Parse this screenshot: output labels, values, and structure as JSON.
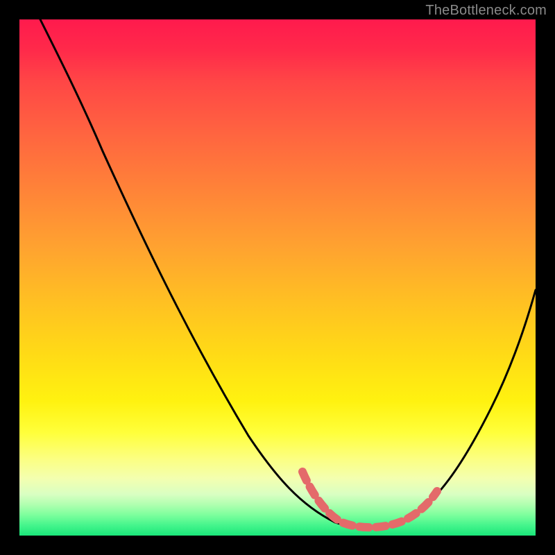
{
  "watermark": "TheBottleneck.com",
  "colors": {
    "background": "#000000",
    "curve_primary": "#000000",
    "curve_accent": "#e46a6a",
    "gradient_top": "#ff1a4d",
    "gradient_mid": "#ffe016",
    "gradient_bottom": "#1ae67a"
  },
  "chart_data": {
    "type": "line",
    "title": "",
    "xlabel": "",
    "ylabel": "",
    "xlim": [
      0,
      100
    ],
    "ylim": [
      0,
      100
    ],
    "grid": false,
    "legend": false,
    "description": "V-shaped bottleneck curve on vertical red-to-green gradient background; minimum plateau sits near the bottom (favorable) region; values estimated from pixel positions, 0 = bottom, 100 = top.",
    "series": [
      {
        "name": "bottleneck-curve-full",
        "color": "#000000",
        "x": [
          4,
          10,
          16,
          22,
          28,
          34,
          40,
          46,
          50,
          54,
          58,
          62,
          66,
          70,
          74,
          78,
          82,
          86,
          90,
          94,
          100
        ],
        "y": [
          100,
          91,
          82,
          72,
          62,
          52,
          42,
          32,
          24,
          17,
          11,
          6,
          3,
          2,
          2,
          3,
          7,
          14,
          24,
          36,
          52
        ]
      },
      {
        "name": "bottleneck-curve-optimal-segment",
        "color": "#e46a6a",
        "x": [
          56,
          58,
          60,
          62,
          64,
          66,
          68,
          70,
          72,
          74,
          76,
          78,
          80
        ],
        "y": [
          12,
          9,
          7,
          5,
          3.5,
          2.5,
          2,
          2,
          2,
          2.2,
          3,
          4,
          6
        ]
      }
    ]
  }
}
